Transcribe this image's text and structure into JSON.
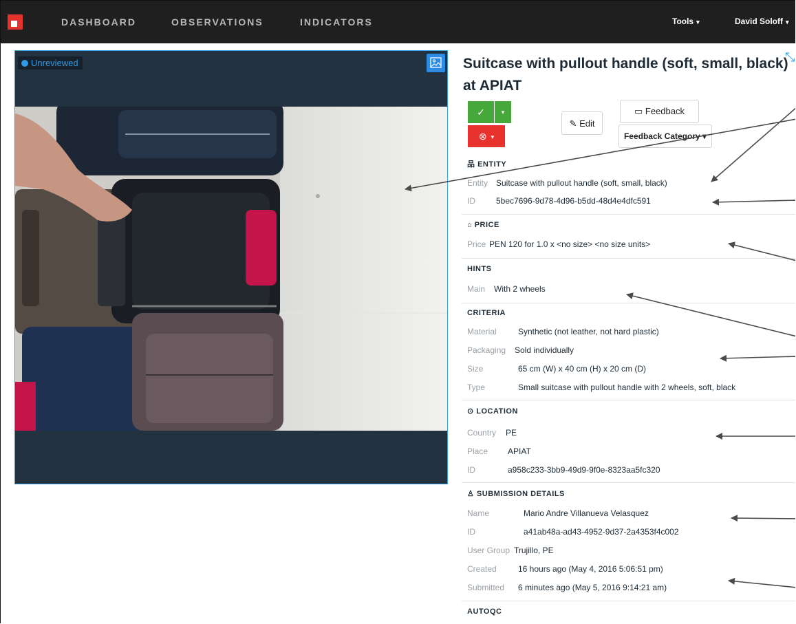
{
  "nav": {
    "items": [
      "DASHBOARD",
      "OBSERVATIONS",
      "INDICATORS"
    ],
    "tools": "Tools",
    "user": "David Soloff"
  },
  "image_panel": {
    "status": "Unreviewed"
  },
  "title": {
    "line1": "Suitcase with pullout handle (soft, small, black)",
    "line2": "at APIAT"
  },
  "actions": {
    "edit": "Edit",
    "feedback": "Feedback",
    "feedback_category": "Feedback Category"
  },
  "entity": {
    "heading": "ENTITY",
    "entity_label": "Entity",
    "entity_value": "Suitcase with pullout handle (soft, small, black)",
    "id_label": "ID",
    "id_value": "5bec7696-9d78-4d96-b5dd-48d4e4dfc591"
  },
  "price": {
    "heading": "PRICE",
    "label": "Price",
    "currency_amount": "PEN 120",
    "for": "for",
    "qty": "1.0",
    "rest": "x <no size> <no size units>"
  },
  "hints": {
    "heading": "HINTS",
    "label": "Main",
    "value": "With 2 wheels"
  },
  "criteria": {
    "heading": "CRITERIA",
    "rows": [
      {
        "label": "Material",
        "value": "Synthetic (not leather, not hard plastic)"
      },
      {
        "label": "Packaging",
        "value": "Sold individually"
      },
      {
        "label": "Size",
        "value": "65 cm (W) x 40 cm (H) x 20 cm (D)"
      },
      {
        "label": "Type",
        "value": "Small suitcase with pullout handle with 2 wheels, soft, black"
      }
    ]
  },
  "location": {
    "heading": "LOCATION",
    "rows": [
      {
        "label": "Country",
        "value": "PE"
      },
      {
        "label": "Place",
        "value": "APIAT"
      },
      {
        "label": "ID",
        "value": "a958c233-3bb9-49d9-9f0e-8323aa5fc320"
      }
    ]
  },
  "submission": {
    "heading": "SUBMISSION DETAILS",
    "rows": [
      {
        "label": "Name",
        "value": "Mario Andre Villanueva Velasquez"
      },
      {
        "label": "ID",
        "value": "a41ab48a-ad43-4952-9d37-2a4353f4c002"
      },
      {
        "label": "User Group",
        "value": "Trujillo, PE"
      },
      {
        "label": "Created",
        "value": "16 hours ago (May 4, 2016 5:06:51 pm)"
      },
      {
        "label": "Submitted",
        "value": "6 minutes ago (May 5, 2016 9:14:21 am)"
      }
    ]
  },
  "autoqc": {
    "heading": "AUTOQC"
  }
}
